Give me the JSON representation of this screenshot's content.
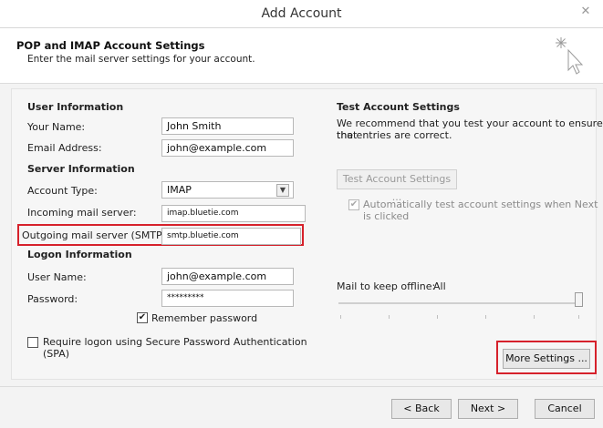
{
  "window": {
    "title": "Add Account",
    "close_glyph": "✕"
  },
  "header": {
    "title": "POP and IMAP Account Settings",
    "subtitle": "Enter the mail server settings for your account.",
    "icon": "cursor-sparkle-icon"
  },
  "user_info": {
    "heading": "User Information",
    "name_label": "Your Name:",
    "name_value": "John Smith",
    "email_label": "Email Address:",
    "email_value": "john@example.com"
  },
  "server_info": {
    "heading": "Server Information",
    "account_type_label": "Account Type:",
    "account_type_value": "IMAP",
    "incoming_label": "Incoming mail server:",
    "incoming_value": "imap.bluetie.com",
    "outgoing_label": "Outgoing mail server (SMTP):",
    "outgoing_value": "smtp.bluetie.com"
  },
  "logon_info": {
    "heading": "Logon Information",
    "username_label": "User Name:",
    "username_value": "john@example.com",
    "password_label": "Password:",
    "password_value": "*********",
    "remember_label": "Remember password",
    "remember_checked": true,
    "spa_label_line1": "Require logon using Secure Password Authentication",
    "spa_label_line2": "(SPA)",
    "spa_checked": false
  },
  "test_settings": {
    "heading": "Test Account Settings",
    "description_line1": "We recommend that you test your account to ensure that",
    "description_line2": "the entries are correct.",
    "test_button": "Test Account Settings ...",
    "auto_test_line1": "Automatically test account settings when Next",
    "auto_test_line2": "is clicked",
    "auto_test_checked": true
  },
  "offline": {
    "label": "Mail to keep offline:",
    "value": "All",
    "slider_level": 1.0
  },
  "buttons": {
    "more_settings": "More Settings ...",
    "back": "< Back",
    "next": "Next >",
    "cancel": "Cancel"
  },
  "colors": {
    "highlight": "#d6212b",
    "background": "#f3f3f3"
  }
}
